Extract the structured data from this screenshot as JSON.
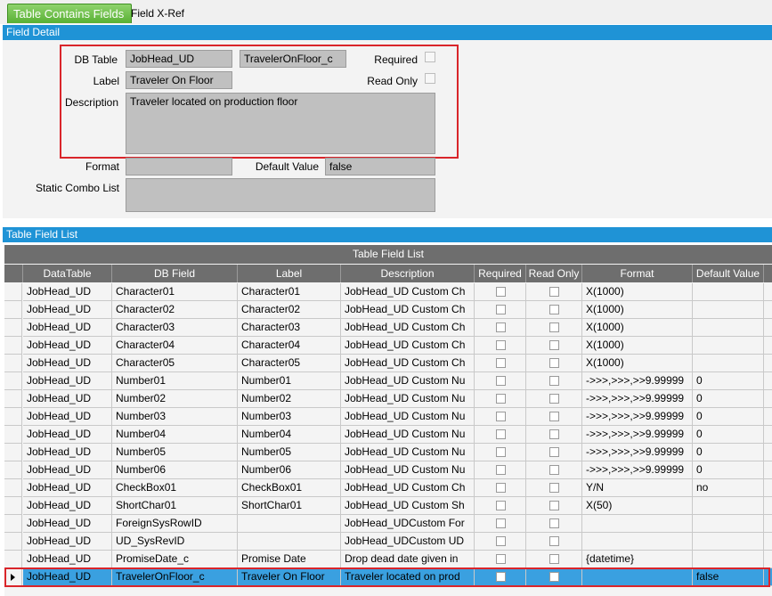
{
  "tabs": [
    {
      "label": "Table Contains Fields",
      "active": true
    },
    {
      "label": "Field X-Ref",
      "active": false
    }
  ],
  "field_detail": {
    "section_title": "Field Detail",
    "db_table_label": "DB Table",
    "db_table_value": "JobHead_UD",
    "field_name_value": "TravelerOnFloor_c",
    "required_label": "Required",
    "label_label": "Label",
    "label_value": "Traveler On Floor",
    "read_only_label": "Read Only",
    "description_label": "Description",
    "description_value": "Traveler located on production floor",
    "format_label": "Format",
    "format_value": "",
    "default_value_label": "Default Value",
    "default_value_value": "false",
    "static_combo_label": "Static Combo List",
    "static_combo_value": ""
  },
  "table_field_list": {
    "section_title": "Table Field List",
    "grid_title": "Table Field List",
    "columns": [
      "DataTable",
      "DB Field",
      "Label",
      "Description",
      "Required",
      "Read Only",
      "Format",
      "Default Value"
    ],
    "rows": [
      [
        "JobHead_UD",
        "Character01",
        "Character01",
        "JobHead_UD Custom Ch",
        false,
        false,
        "X(1000)",
        ""
      ],
      [
        "JobHead_UD",
        "Character02",
        "Character02",
        "JobHead_UD Custom Ch",
        false,
        false,
        "X(1000)",
        ""
      ],
      [
        "JobHead_UD",
        "Character03",
        "Character03",
        "JobHead_UD Custom Ch",
        false,
        false,
        "X(1000)",
        ""
      ],
      [
        "JobHead_UD",
        "Character04",
        "Character04",
        "JobHead_UD Custom Ch",
        false,
        false,
        "X(1000)",
        ""
      ],
      [
        "JobHead_UD",
        "Character05",
        "Character05",
        "JobHead_UD Custom Ch",
        false,
        false,
        "X(1000)",
        ""
      ],
      [
        "JobHead_UD",
        "Number01",
        "Number01",
        "JobHead_UD Custom Nu",
        false,
        false,
        "->>>,>>>,>>9.99999",
        "0"
      ],
      [
        "JobHead_UD",
        "Number02",
        "Number02",
        "JobHead_UD Custom Nu",
        false,
        false,
        "->>>,>>>,>>9.99999",
        "0"
      ],
      [
        "JobHead_UD",
        "Number03",
        "Number03",
        "JobHead_UD Custom Nu",
        false,
        false,
        "->>>,>>>,>>9.99999",
        "0"
      ],
      [
        "JobHead_UD",
        "Number04",
        "Number04",
        "JobHead_UD Custom Nu",
        false,
        false,
        "->>>,>>>,>>9.99999",
        "0"
      ],
      [
        "JobHead_UD",
        "Number05",
        "Number05",
        "JobHead_UD Custom Nu",
        false,
        false,
        "->>>,>>>,>>9.99999",
        "0"
      ],
      [
        "JobHead_UD",
        "Number06",
        "Number06",
        "JobHead_UD Custom Nu",
        false,
        false,
        "->>>,>>>,>>9.99999",
        "0"
      ],
      [
        "JobHead_UD",
        "CheckBox01",
        "CheckBox01",
        "JobHead_UD Custom Ch",
        false,
        false,
        "Y/N",
        "no"
      ],
      [
        "JobHead_UD",
        "ShortChar01",
        "ShortChar01",
        "JobHead_UD Custom Sh",
        false,
        false,
        "X(50)",
        ""
      ],
      [
        "JobHead_UD",
        "ForeignSysRowID",
        "",
        "JobHead_UDCustom For",
        false,
        false,
        "",
        ""
      ],
      [
        "JobHead_UD",
        "UD_SysRevID",
        "",
        "JobHead_UDCustom UD",
        false,
        false,
        "",
        ""
      ],
      [
        "JobHead_UD",
        "PromiseDate_c",
        "Promise Date",
        "Drop dead date given in",
        false,
        false,
        "{datetime}",
        ""
      ],
      [
        "JobHead_UD",
        "TravelerOnFloor_c",
        "Traveler On Floor",
        "Traveler located on prod",
        false,
        false,
        "",
        "false"
      ]
    ],
    "selected_row_index": 16
  },
  "colors": {
    "accent_blue": "#1f93d6",
    "active_tab_green": "#58b034",
    "highlight_red": "#d9252a",
    "selected_row": "#3aa0e0"
  }
}
